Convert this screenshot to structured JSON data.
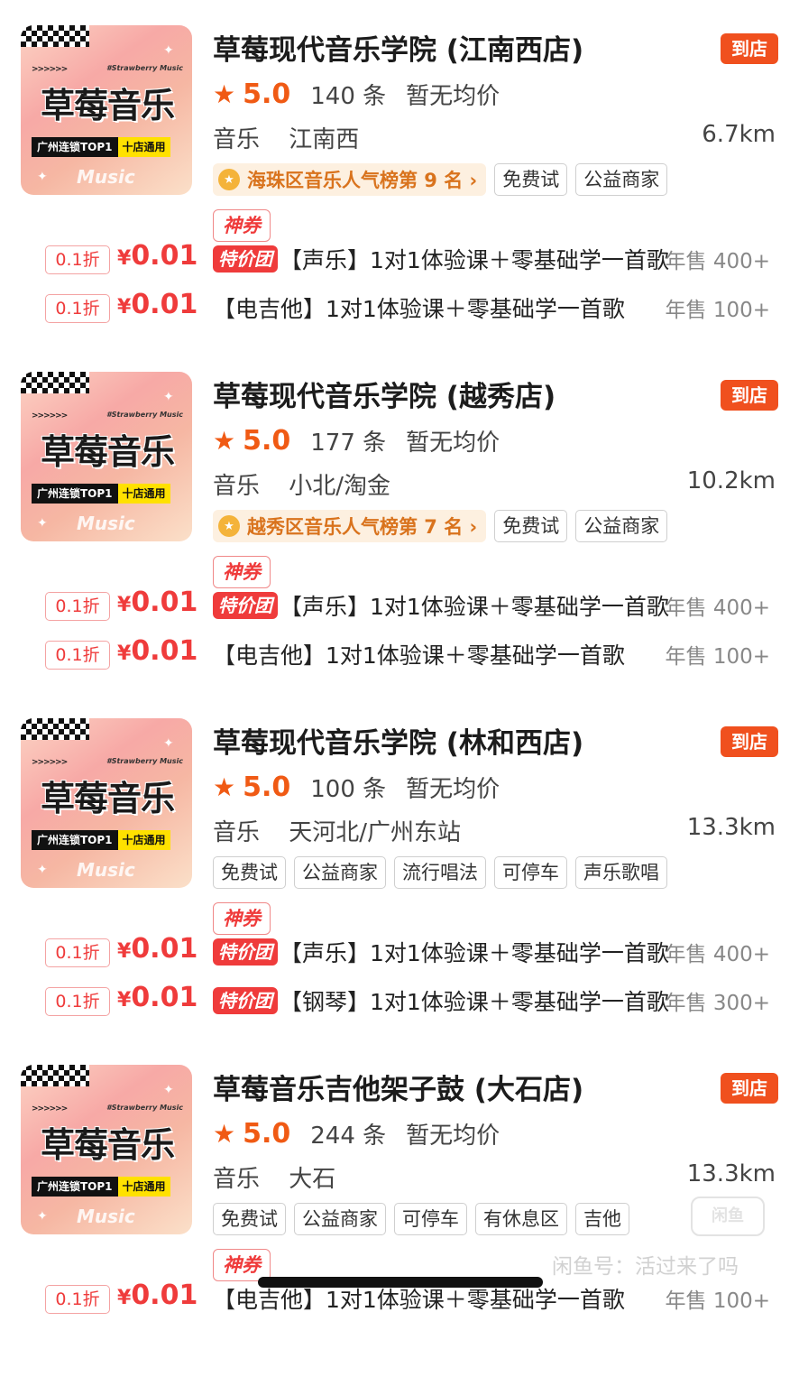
{
  "shops": [
    {
      "thumb": {
        "sub": "#Strawberry Music",
        "arrows": ">>>>>>",
        "title": "草莓音乐",
        "band_left": "广州连锁TOP1",
        "band_right": "十店通用",
        "music": "Music"
      },
      "name": "草莓现代音乐学院 (江南西店)",
      "daodian": "到店",
      "score": "5.0",
      "reviews": "140 条",
      "avg_price": "暂无均价",
      "category": "音乐",
      "area": "江南西",
      "distance": "6.7km",
      "rank": "海珠区音乐人气榜第 9 名 ›",
      "tags": [
        "免费试",
        "公益商家"
      ],
      "coupon": "神券",
      "deals": [
        {
          "discount": "0.1折",
          "yen": "¥",
          "price": "0.01",
          "badge": "特价团",
          "name": "【声乐】1对1体验课＋零基础学一首歌",
          "sales": "年售 400+"
        },
        {
          "discount": "0.1折",
          "yen": "¥",
          "price": "0.01",
          "badge": "",
          "name": "【电吉他】1对1体验课＋零基础学一首歌",
          "sales": "年售 100+"
        }
      ]
    },
    {
      "thumb": {
        "sub": "#Strawberry Music",
        "arrows": ">>>>>>",
        "title": "草莓音乐",
        "band_left": "广州连锁TOP1",
        "band_right": "十店通用",
        "music": "Music"
      },
      "name": "草莓现代音乐学院 (越秀店)",
      "daodian": "到店",
      "score": "5.0",
      "reviews": "177 条",
      "avg_price": "暂无均价",
      "category": "音乐",
      "area": "小北/淘金",
      "distance": "10.2km",
      "rank": "越秀区音乐人气榜第 7 名 ›",
      "tags": [
        "免费试",
        "公益商家"
      ],
      "coupon": "神券",
      "deals": [
        {
          "discount": "0.1折",
          "yen": "¥",
          "price": "0.01",
          "badge": "特价团",
          "name": "【声乐】1对1体验课＋零基础学一首歌",
          "sales": "年售 400+"
        },
        {
          "discount": "0.1折",
          "yen": "¥",
          "price": "0.01",
          "badge": "",
          "name": "【电吉他】1对1体验课＋零基础学一首歌",
          "sales": "年售 100+"
        }
      ]
    },
    {
      "thumb": {
        "sub": "#Strawberry Music",
        "arrows": ">>>>>>",
        "title": "草莓音乐",
        "band_left": "广州连锁TOP1",
        "band_right": "十店通用",
        "music": "Music"
      },
      "name": "草莓现代音乐学院 (林和西店)",
      "daodian": "到店",
      "score": "5.0",
      "reviews": "100 条",
      "avg_price": "暂无均价",
      "category": "音乐",
      "area": "天河北/广州东站",
      "distance": "13.3km",
      "rank": "",
      "tags": [
        "免费试",
        "公益商家",
        "流行唱法",
        "可停车",
        "声乐歌唱"
      ],
      "coupon": "神券",
      "deals": [
        {
          "discount": "0.1折",
          "yen": "¥",
          "price": "0.01",
          "badge": "特价团",
          "name": "【声乐】1对1体验课＋零基础学一首歌",
          "sales": "年售 400+"
        },
        {
          "discount": "0.1折",
          "yen": "¥",
          "price": "0.01",
          "badge": "特价团",
          "name": "【钢琴】1对1体验课＋零基础学一首歌",
          "sales": "年售 300+"
        }
      ]
    },
    {
      "thumb": {
        "sub": "#Strawberry Music",
        "arrows": ">>>>>>",
        "title": "草莓音乐",
        "band_left": "广州连锁TOP1",
        "band_right": "十店通用",
        "music": "Music"
      },
      "name": "草莓音乐吉他架子鼓 (大石店)",
      "daodian": "到店",
      "score": "5.0",
      "reviews": "244 条",
      "avg_price": "暂无均价",
      "category": "音乐",
      "area": "大石",
      "distance": "13.3km",
      "rank": "",
      "tags": [
        "免费试",
        "公益商家",
        "可停车",
        "有休息区",
        "吉他"
      ],
      "coupon": "神券",
      "deals": [
        {
          "discount": "0.1折",
          "yen": "¥",
          "price": "0.01",
          "badge": "",
          "name": "【电吉他】1对1体验课＋零基础学一首歌",
          "sales": "年售 100+"
        }
      ]
    }
  ],
  "overlay": {
    "watermark": "闲鱼号：活过来了吗",
    "logo": "闲鱼"
  },
  "colors": {
    "accent": "#f05a14",
    "price_red": "#ef3b3b",
    "daodian_bg": "#f0501e"
  }
}
